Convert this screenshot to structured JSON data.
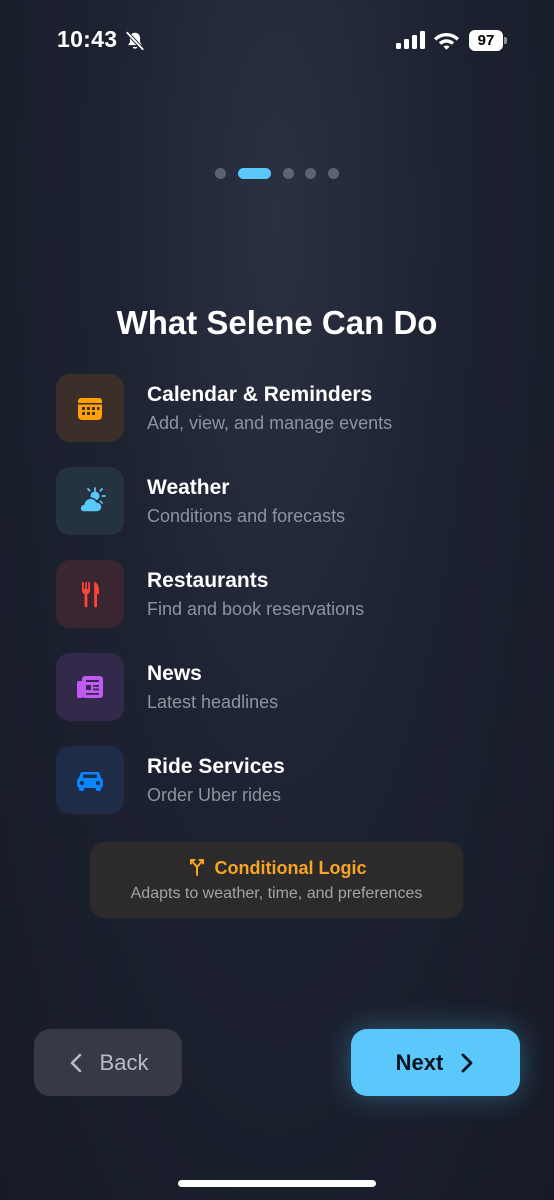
{
  "status_bar": {
    "time": "10:43",
    "battery": "97"
  },
  "pager": {
    "total": 5,
    "active_index": 1
  },
  "title": "What Selene Can Do",
  "features": [
    {
      "title": "Calendar & Reminders",
      "subtitle": "Add, view, and manage events",
      "icon": "calendar-icon",
      "color": "#ff9f0a",
      "bg": "#3b2f29"
    },
    {
      "title": "Weather",
      "subtitle": "Conditions and forecasts",
      "icon": "cloud-sun-icon",
      "color": "#5ac8fa",
      "bg": "#243242"
    },
    {
      "title": "Restaurants",
      "subtitle": "Find and book reservations",
      "icon": "fork-knife-icon",
      "color": "#ff453a",
      "bg": "#3a2630"
    },
    {
      "title": "News",
      "subtitle": "Latest headlines",
      "icon": "newspaper-icon",
      "color": "#bf5af2",
      "bg": "#33294a"
    },
    {
      "title": "Ride Services",
      "subtitle": "Order Uber rides",
      "icon": "car-icon",
      "color": "#0a84ff",
      "bg": "#1f2c48"
    }
  ],
  "conditional": {
    "title": "Conditional Logic",
    "subtitle": "Adapts to weather, time, and preferences",
    "icon": "branch-icon",
    "color": "#f5a623"
  },
  "buttons": {
    "back": "Back",
    "next": "Next"
  },
  "colors": {
    "accent": "#5ac8fa"
  }
}
